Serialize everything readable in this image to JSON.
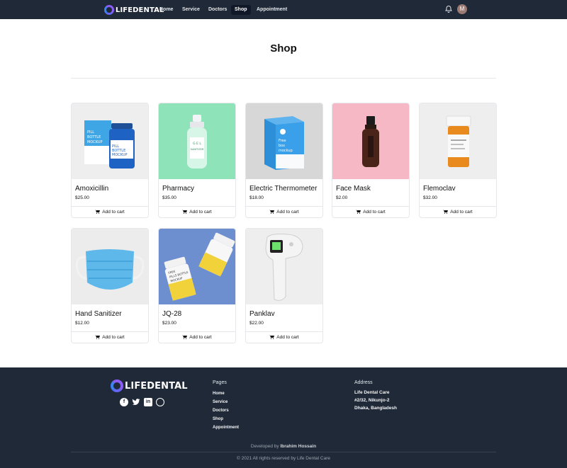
{
  "nav": {
    "brand": "LIFEDENTAL",
    "links": [
      "Home",
      "Service",
      "Doctors",
      "Shop",
      "Appointment"
    ],
    "active": "Shop",
    "avatar_initial": "M"
  },
  "page": {
    "title": "Shop"
  },
  "cart_label": "Add to cart",
  "products": [
    {
      "name": "Amoxicillin",
      "price": "$25.00",
      "bg": "#eeeeee",
      "box_text": [
        "PILL",
        "BOTTLE",
        "MOCKUP"
      ]
    },
    {
      "name": "Pharmacy",
      "price": "$35.00",
      "bg": "#8ee3b8",
      "bottle_text": [
        "G E L",
        "SANITIZER"
      ]
    },
    {
      "name": "Electric Thermometer",
      "price": "$18.00",
      "bg": "#d7d7d7",
      "box_text": [
        "Free",
        "box",
        "mockup"
      ]
    },
    {
      "name": "Face Mask",
      "price": "$2.00",
      "bg": "#f5b8c4"
    },
    {
      "name": "Flemoclav",
      "price": "$32.00",
      "bg": "#eeeeee"
    },
    {
      "name": "Hand Sanitizer",
      "price": "$12.00",
      "bg": "#ececec"
    },
    {
      "name": "JQ-28",
      "price": "$23.00",
      "bg": "#6d8fd0",
      "bottle_text": [
        "FREE",
        "PILLS BOTTLE",
        "MOCKUP"
      ]
    },
    {
      "name": "Panklav",
      "price": "$22.00",
      "bg": "#eeeeee"
    }
  ],
  "footer": {
    "brand": "LIFEDENTAL",
    "pages_heading": "Pages",
    "pages": [
      "Home",
      "Service",
      "Doctors",
      "Shop",
      "Appointment"
    ],
    "address_heading": "Address",
    "address": [
      "Life Dental Care",
      "#2/32, Nikunjo-2",
      "Dhaka, Bangladesh"
    ],
    "developed_prefix": "Developed by",
    "developer": "Ibrahim Hossain",
    "copyright": "© 2021 All rights reserved by Life Dental Care"
  },
  "icons": [
    "bell-icon",
    "cart-icon",
    "facebook-icon",
    "twitter-icon",
    "linkedin-icon",
    "dribbble-icon"
  ]
}
